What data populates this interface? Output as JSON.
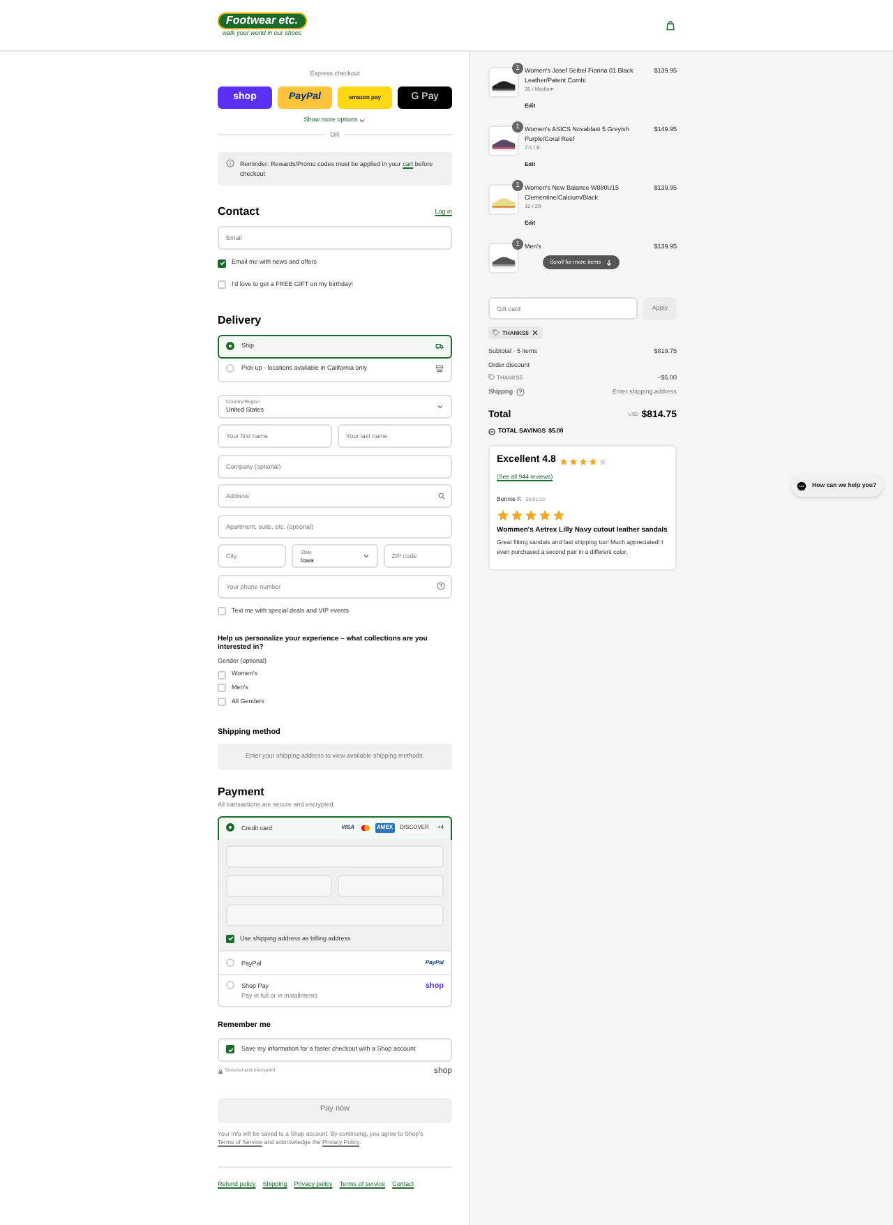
{
  "header": {
    "logo": "Footwear etc.",
    "tagline": "walk your world in our shoes"
  },
  "express_checkout": {
    "label": "Express checkout",
    "buttons": [
      {
        "kind": "shop",
        "label": "shop"
      },
      {
        "kind": "paypal",
        "label": "PayPal"
      },
      {
        "kind": "amazon",
        "label": "amazon pay"
      },
      {
        "kind": "gpay",
        "label": "G Pay"
      }
    ],
    "more": "Show more options",
    "separator": "OR"
  },
  "notice": {
    "before": "Reminder: Rewards/Promo codes must be applied in your ",
    "link": "cart",
    "after": " before checkout"
  },
  "contact": {
    "title": "Contact",
    "login": "Log in",
    "email_placeholder": "Email",
    "checkboxes": [
      {
        "label": "Email me with news and offers",
        "checked": true
      },
      {
        "label": "I'd love to get a FREE GIFT on my birthday!",
        "checked": false
      }
    ]
  },
  "delivery": {
    "title": "Delivery",
    "options": [
      {
        "kind": "truck",
        "label": "Ship",
        "selected": true
      },
      {
        "kind": "store",
        "label": "Pick up - locations available in California only",
        "selected": false
      }
    ],
    "rows": [
      [
        {
          "kind": "select",
          "label": "Country/Region",
          "value": "United States"
        }
      ],
      [
        {
          "kind": "text",
          "placeholder": "Your first name"
        },
        {
          "kind": "text",
          "placeholder": "Your last name"
        }
      ],
      [
        {
          "kind": "text",
          "placeholder": "Company (optional)"
        }
      ],
      [
        {
          "kind": "search",
          "placeholder": "Address"
        }
      ],
      [
        {
          "kind": "text",
          "placeholder": "Apartment, suite, etc. (optional)"
        }
      ],
      [
        {
          "kind": "text",
          "placeholder": "City"
        },
        {
          "kind": "select",
          "label": "State",
          "value": "Iowa"
        },
        {
          "kind": "text",
          "placeholder": "ZIP code"
        }
      ],
      [
        {
          "kind": "help",
          "placeholder": "Your phone number"
        }
      ]
    ],
    "sms": {
      "label": "Text me with special deals and VIP events",
      "checked": false
    }
  },
  "personalize": {
    "question": "Help us personalize your experience – what collections are you interested in?",
    "group_label": "Gender (optional)",
    "options": [
      {
        "label": "Women's",
        "checked": false
      },
      {
        "label": "Men's",
        "checked": false
      },
      {
        "label": "All Genders",
        "checked": false
      }
    ]
  },
  "shipping_method": {
    "title": "Shipping method",
    "message": "Enter your shipping address to view available shipping methods."
  },
  "payment": {
    "title": "Payment",
    "subtitle": "All transactions are secure and encrypted.",
    "methods": [
      {
        "kind": "card",
        "label": "Credit card",
        "selected": true,
        "brands": [
          {
            "kind": "visa",
            "label": "VISA"
          },
          {
            "kind": "mastercard"
          },
          {
            "kind": "amex",
            "label": "AMEX"
          },
          {
            "kind": "discover",
            "label": "DISCOVER"
          }
        ],
        "more": "+4",
        "billing": {
          "label": "Use shipping address as billing address",
          "checked": true
        }
      },
      {
        "kind": "paypal",
        "label": "PayPal",
        "selected": false,
        "brand": "PayPal"
      },
      {
        "kind": "shoppay",
        "label": "Shop Pay",
        "selected": false,
        "brand": "shop",
        "sublabel": "Pay in full or in installments"
      }
    ]
  },
  "remember": {
    "title": "Remember me",
    "checkbox": {
      "label": "Save my information for a faster checkout with a Shop account",
      "checked": true
    },
    "secured": "Secured and encrypted",
    "brand": "shop"
  },
  "pay_button": "Pay now",
  "legal": {
    "before": "Your info will be saved to a Shop account. By continuing, you agree to Shop's ",
    "link1": "Terms of Service",
    "middle": " and acknowledge the ",
    "link2": "Privacy Policy",
    "after": "."
  },
  "footer_links": [
    "Refund policy",
    "Shipping",
    "Privacy policy",
    "Terms of service",
    "Contact"
  ],
  "cart": {
    "items": [
      {
        "name": "Women's Josef Seibel Fiorina 01 Black Leather/Patent Combi",
        "variant": "35 / Medium",
        "quantity": "1",
        "price": "$139.95",
        "edit": "Edit"
      },
      {
        "name": "Women's ASICS Novablast 5 Greyish Purple/Coral Reef",
        "variant": "7.5 / B",
        "quantity": "1",
        "price": "$149.95",
        "edit": "Edit"
      },
      {
        "name": "Women's New Balance W880U15 Clementine/Calcium/Black",
        "variant": "10 / 2A",
        "quantity": "1",
        "price": "$139.95",
        "edit": "Edit"
      },
      {
        "name": "Men's",
        "quantity": "1",
        "price": "$139.95"
      }
    ],
    "scroll_hint": "Scroll for more items",
    "gift_card": {
      "placeholder": "Gift card",
      "button": "Apply"
    },
    "discount_tag": "THANKS5",
    "summary": [
      {
        "kind": "row",
        "label": "Subtotal · 5 items",
        "value": "$819.75"
      },
      {
        "kind": "heading",
        "label": "Order discount"
      },
      {
        "kind": "discount",
        "label": "THANKS5",
        "value": "−$5.00"
      },
      {
        "kind": "shipping",
        "label": "Shipping",
        "value": "Enter shipping address"
      }
    ],
    "total": {
      "label": "Total",
      "currency": "USD",
      "amount": "$814.75"
    },
    "savings": {
      "label": "TOTAL SAVINGS",
      "amount": "$5.00"
    }
  },
  "reviews": {
    "title": "Excellent 4.8",
    "stars": 4,
    "link": "(See all 944 reviews)",
    "review": {
      "author": "Bonnie F.",
      "date": "06/01/25",
      "stars": 5,
      "product": "Wommen's Aetrex Lilly Navy cutout leather sandals",
      "body": "Great fitting sandals and fast shipping too! Much appreciated! I even purchased a second pair in a different color."
    }
  },
  "chat": {
    "label": "How can we help you?"
  }
}
